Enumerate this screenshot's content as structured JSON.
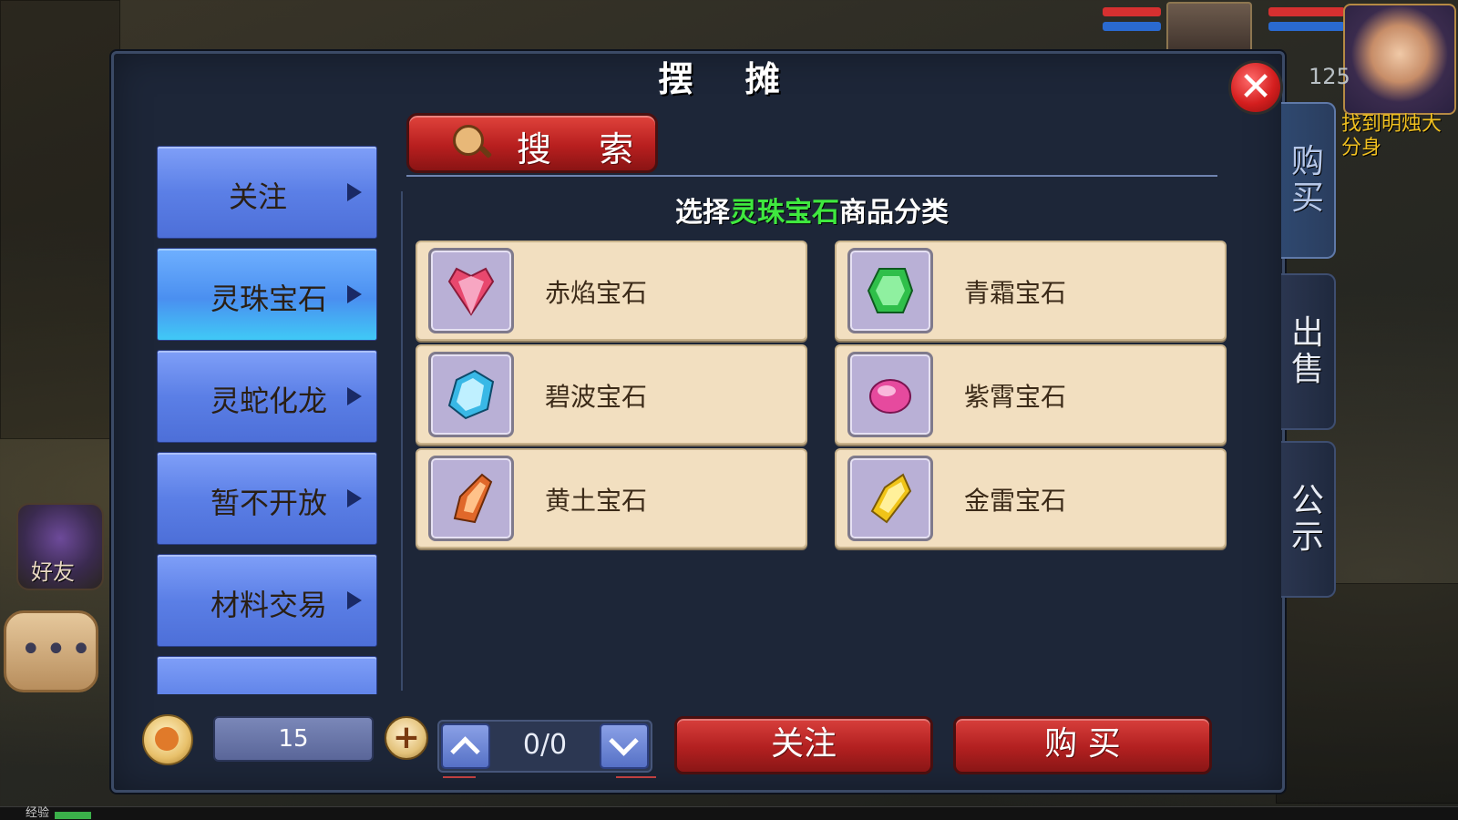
{
  "dialog": {
    "title": "摆 摊"
  },
  "search": {
    "label": "搜 索"
  },
  "heading": {
    "prefix": "选择",
    "highlight": "灵珠宝石",
    "suffix": "商品分类"
  },
  "categories": [
    {
      "label": "关注"
    },
    {
      "label": "灵珠宝石"
    },
    {
      "label": "灵蛇化龙"
    },
    {
      "label": "暂不开放"
    },
    {
      "label": "材料交易"
    }
  ],
  "gems": [
    {
      "name": "赤焰宝石",
      "color": "#e8486e"
    },
    {
      "name": "青霜宝石",
      "color": "#2fbf4a"
    },
    {
      "name": "碧波宝石",
      "color": "#39b8e6"
    },
    {
      "name": "紫霄宝石",
      "color": "#e64a9e"
    },
    {
      "name": "黄土宝石",
      "color": "#e0682a"
    },
    {
      "name": "金雷宝石",
      "color": "#f0c418"
    }
  ],
  "footer": {
    "money": "15",
    "page": "0/0",
    "follow_label": "关注",
    "buy_label": "购 买"
  },
  "side_tabs": [
    {
      "label": "购\n买"
    },
    {
      "label": "出\n售"
    },
    {
      "label": "公\n示"
    }
  ],
  "hud": {
    "level": "125",
    "quest": "找到明烛大\n分身",
    "friend_label": "好友",
    "exp_label": "经验"
  }
}
